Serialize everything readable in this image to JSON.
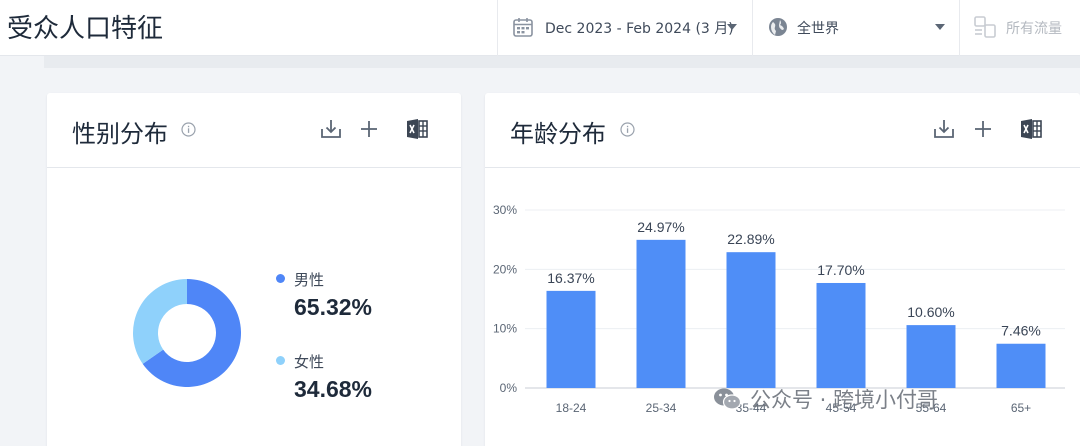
{
  "header": {
    "title": "受众人口特征",
    "date_range": "Dec 2023 - Feb 2024 (3 月)",
    "region": "全世界",
    "traffic": "所有流量"
  },
  "gender_card": {
    "title": "性别分布",
    "legend": [
      {
        "label": "男性",
        "value": "65.32%",
        "color": "#4f86f7"
      },
      {
        "label": "女性",
        "value": "34.68%",
        "color": "#8fd1fb"
      }
    ],
    "icons": [
      "info-icon",
      "download-icon",
      "plus-icon",
      "excel-icon"
    ]
  },
  "age_card": {
    "title": "年龄分布",
    "icons": [
      "info-icon",
      "download-icon",
      "plus-icon",
      "excel-icon"
    ]
  },
  "chart_data": [
    {
      "type": "pie",
      "variant": "donut",
      "labels": [
        "男性",
        "女性"
      ],
      "values": [
        65.32,
        34.68
      ],
      "colors": [
        "#4f86f7",
        "#8fd1fb"
      ]
    },
    {
      "type": "bar",
      "categories": [
        "18-24",
        "25-34",
        "35-44",
        "45-54",
        "55-64",
        "65+"
      ],
      "values": [
        16.37,
        24.97,
        22.89,
        17.7,
        10.6,
        7.46
      ],
      "value_labels": [
        "16.37%",
        "24.97%",
        "22.89%",
        "17.70%",
        "10.60%",
        "7.46%"
      ],
      "yticks": [
        "0%",
        "10%",
        "20%",
        "30%"
      ],
      "ylim": [
        0,
        30
      ],
      "grid": true,
      "color": "#4f8ef7"
    }
  ],
  "watermark": {
    "text": "公众号 · 跨境小付哥"
  }
}
